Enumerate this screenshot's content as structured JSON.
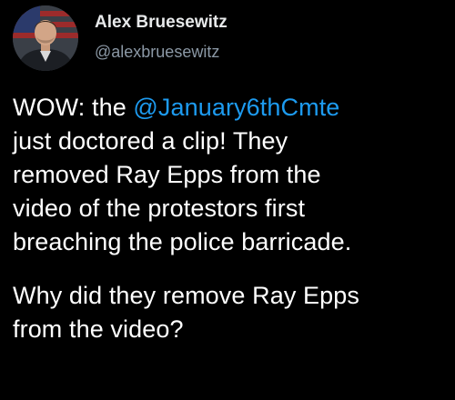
{
  "user": {
    "display_name": "Alex Bruesewitz",
    "handle": "@alexbruesewitz"
  },
  "tweet": {
    "paragraph1": {
      "line1_prefix": "WOW: the ",
      "line1_mention": "@January6thCmte",
      "line2": "just doctored a clip! They",
      "line3": "removed Ray Epps from the",
      "line4": "video of the protestors first",
      "line5": "breaching the police barricade."
    },
    "paragraph2": {
      "line1": "Why did they remove Ray Epps",
      "line2": "from the video?"
    }
  },
  "colors": {
    "background": "#000000",
    "text": "#ffffff",
    "mention": "#1d9bf0",
    "handle": "#8b98a5"
  }
}
